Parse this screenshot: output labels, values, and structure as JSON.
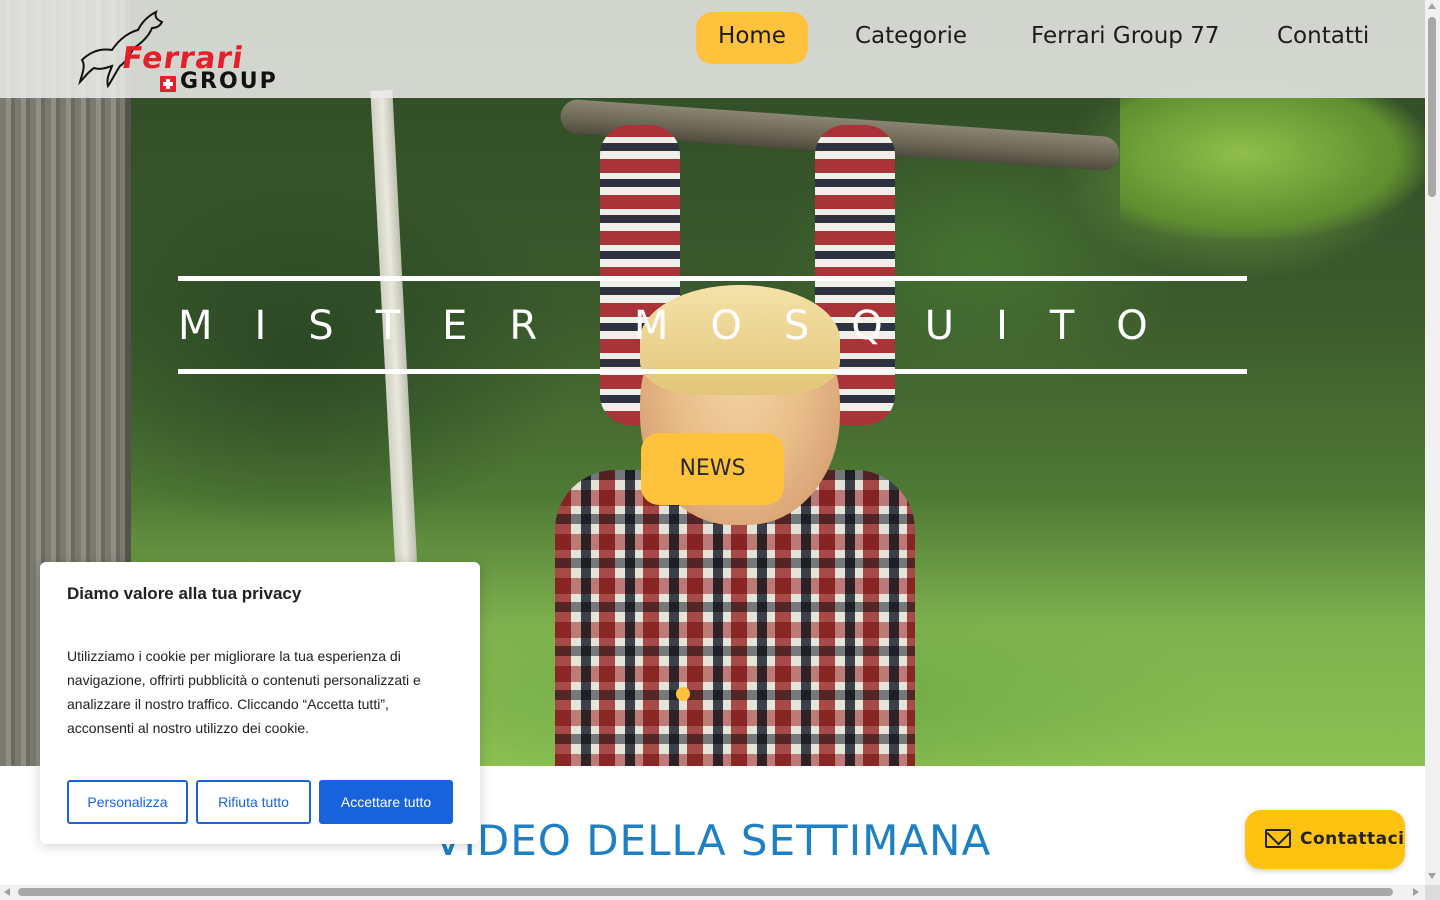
{
  "brand": {
    "logo_word": "Ferrari",
    "logo_sub": "GROUP",
    "accent_color": "#fec23c",
    "brand_red": "#e6202b",
    "link_blue": "#1863dc",
    "title_blue": "#1d7fc4"
  },
  "nav": {
    "items": [
      {
        "label": "Home",
        "active": true
      },
      {
        "label": "Categorie",
        "active": false
      },
      {
        "label": "Ferrari Group 77",
        "active": false
      },
      {
        "label": "Contatti",
        "active": false
      }
    ]
  },
  "hero": {
    "title": "MISTER MOSQUITO",
    "button_label": "NEWS",
    "slides_total": 1,
    "active_slide": 1
  },
  "section": {
    "title": "VIDEO DELLA SETTIMANA"
  },
  "cookie": {
    "title": "Diamo valore alla tua privacy",
    "text": "Utilizziamo i cookie per migliorare la tua esperienza di navigazione, offrirti pubblicità o contenuti personalizzati e analizzare il nostro traffico. Cliccando “Accetta tutti”, acconsenti al nostro utilizzo dei cookie.",
    "buttons": {
      "customize": "Personalizza",
      "reject": "Rifiuta tutto",
      "accept": "Accettare tutto"
    }
  },
  "contact_float": {
    "label": "Contattaci",
    "icon": "mail-icon"
  }
}
